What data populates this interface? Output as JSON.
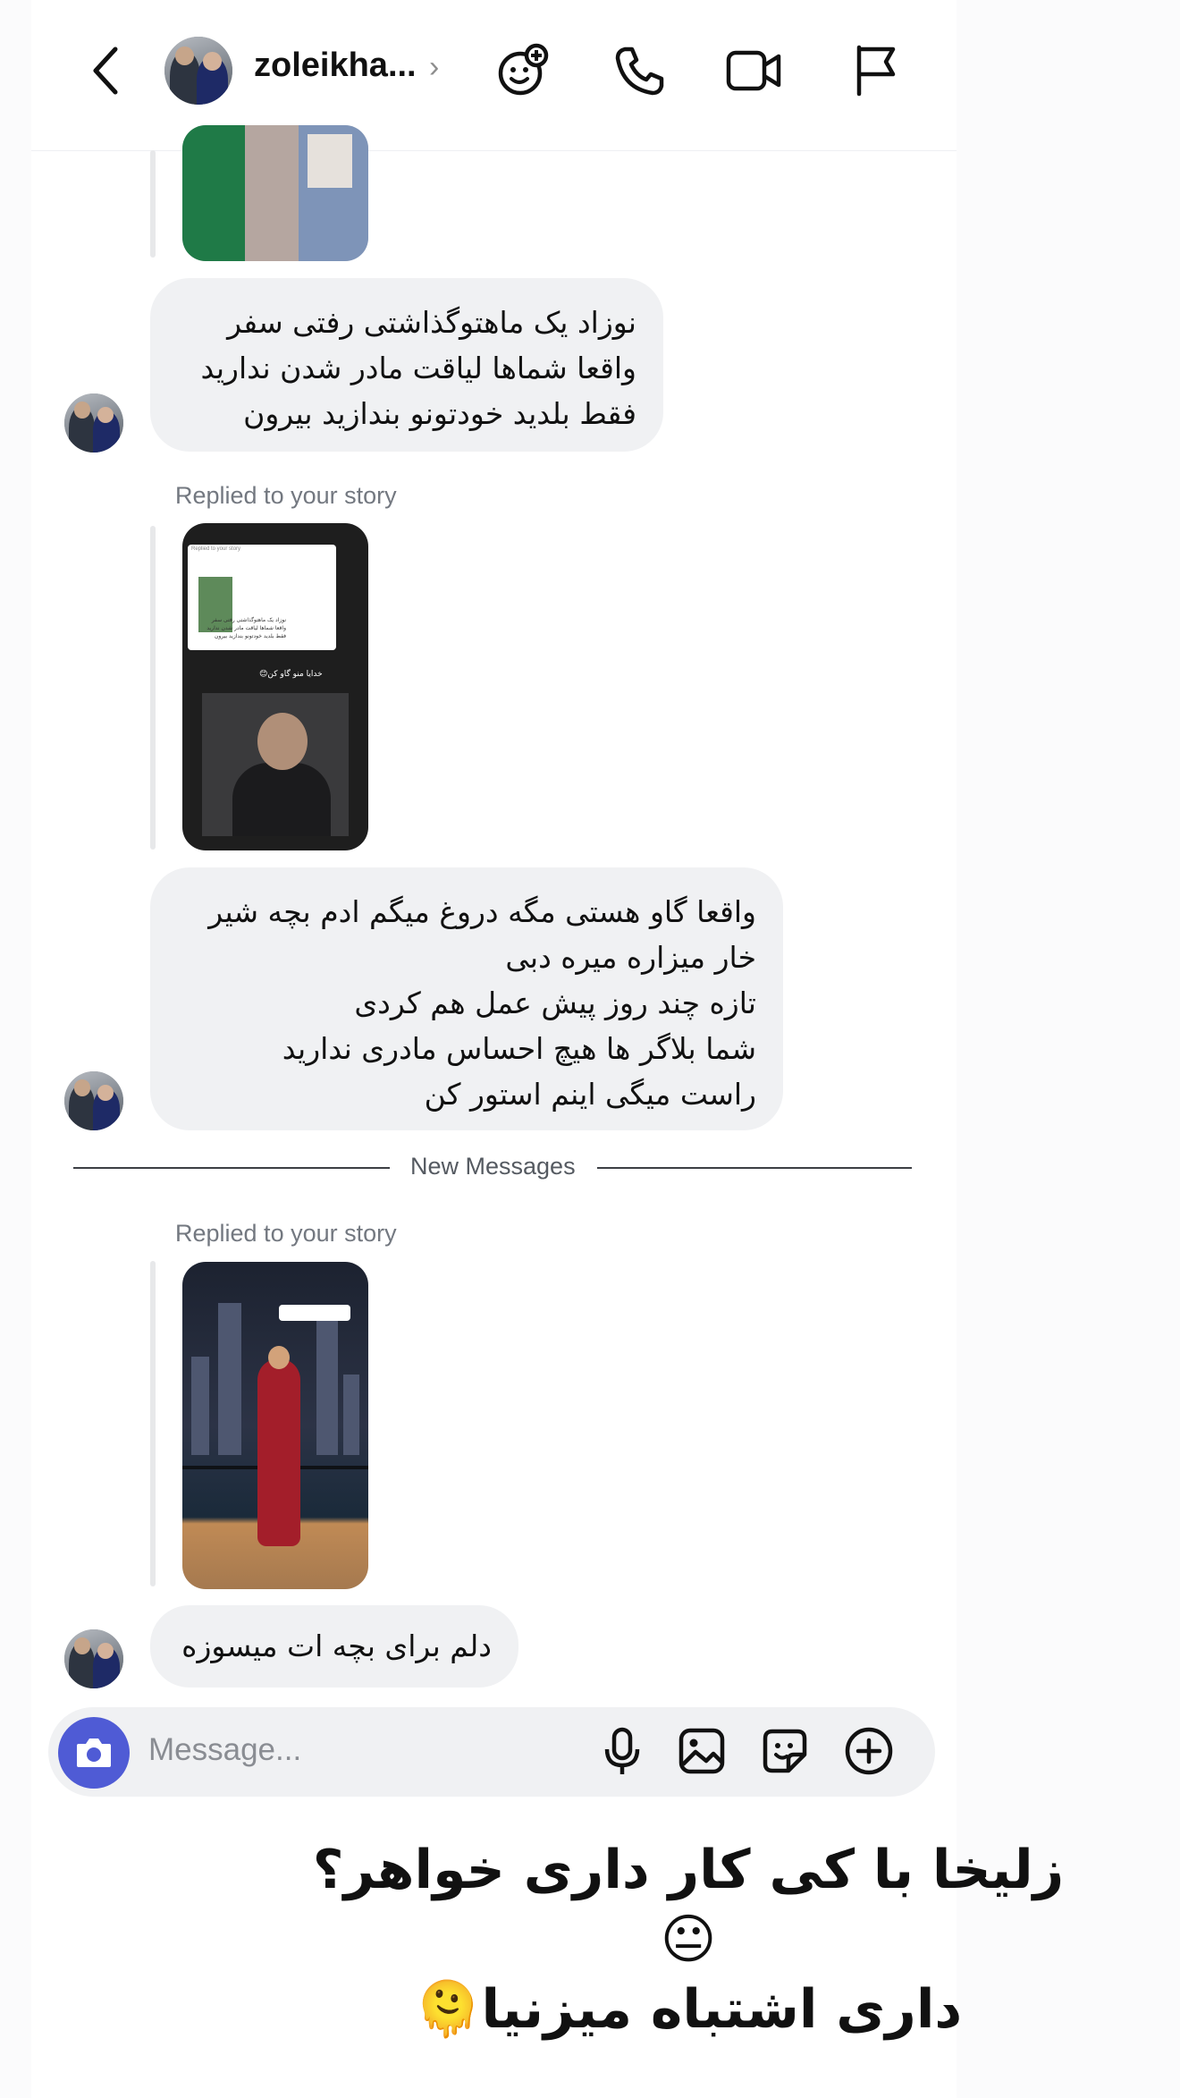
{
  "header": {
    "username": "zoleikha...",
    "chevron": "›",
    "icons": [
      "back-arrow-icon",
      "effects-icon",
      "phone-icon",
      "video-camera-icon",
      "flag-icon"
    ]
  },
  "messages": [
    {
      "type": "text",
      "text": "نوزاد یک ماهتوگذاشتی رفتی سفر\nواقعا شماها لیاقت مادر شدن ندارید\nفقط بلدید خودتونو بندازید بیرون"
    },
    {
      "type": "story_reply",
      "label": "Replied to your story",
      "story_texts": {
        "mini_label": "Replied to your story",
        "mini_text": "نوزاد یک ماهتوگذاشتی رفتی سفر\nواقعا شماها لیاقت مادر شدن ندارید\nفقط بلدید خودتونو بندازید بیرون",
        "caption": "خدایا منو گاو کن😊"
      }
    },
    {
      "type": "text",
      "text": "واقعا گاو هستی مگه دروغ میگم ادم بچه شیر\nخار میزاره میره دبی\nتازه چند روز پیش عمل هم کردی\nشما بلاگر ها هیچ احساس مادری ندارید\nراست میگی اینم استور کن"
    },
    {
      "type": "story_reply",
      "label": "Replied to your story"
    },
    {
      "type": "text",
      "text": "دلم برای بچه ات میسوزه"
    }
  ],
  "divider": {
    "label": "New Messages"
  },
  "composer": {
    "placeholder": "Message...",
    "icons": [
      "camera-icon",
      "microphone-icon",
      "gallery-icon",
      "sticker-icon",
      "plus-icon"
    ],
    "camera_color": "#4f5bd5"
  },
  "overlay": {
    "text": "زلیخا با کی کار داری خواهر؟😐\nداری اشتباه میزنیا🫠"
  }
}
